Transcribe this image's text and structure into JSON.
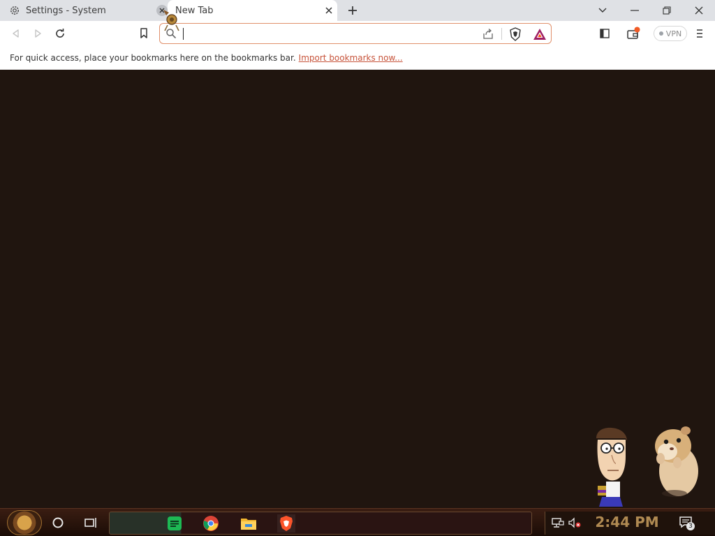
{
  "tabs": [
    {
      "title": "Settings - System",
      "icon": "gear-icon",
      "active": false
    },
    {
      "title": "New Tab",
      "icon": "",
      "active": true
    }
  ],
  "omnibox": {
    "value": "",
    "placeholder": ""
  },
  "vpn": {
    "label": "VPN",
    "status_color": "#9ea3a8"
  },
  "bookmarks_bar": {
    "message": "For quick access, place your bookmarks here on the bookmarks bar.",
    "link_text": "Import bookmarks now..."
  },
  "taskbar": {
    "pinned_apps": [
      "spotify-like-icon",
      "chrome-icon",
      "file-explorer-icon",
      "brave-icon"
    ],
    "clock": "2:44 PM",
    "notification_count": "3"
  },
  "colors": {
    "content_background": "#20150f",
    "omnibox_border": "#e08f6a",
    "link": "#c7533a",
    "wallet_badge": "#f15a24"
  }
}
